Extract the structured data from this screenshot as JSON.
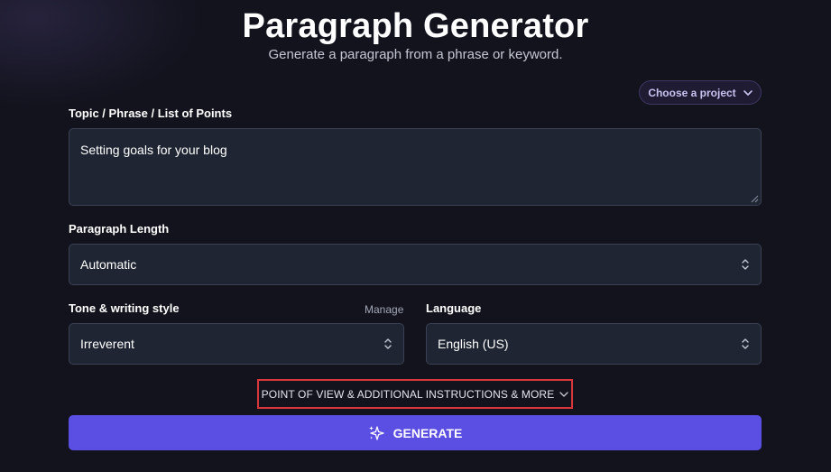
{
  "header": {
    "title": "Paragraph Generator",
    "subtitle": "Generate a paragraph from a phrase or keyword."
  },
  "project": {
    "label": "Choose a project",
    "icon": "chevron-down-icon"
  },
  "topic": {
    "label": "Topic / Phrase / List of Points",
    "value": "Setting goals for your blog"
  },
  "length": {
    "label": "Paragraph Length",
    "value": "Automatic",
    "icon": "chevron-up-down-icon"
  },
  "tone": {
    "label": "Tone & writing style",
    "manage_label": "Manage",
    "value": "Irreverent",
    "icon": "chevron-up-down-icon"
  },
  "language": {
    "label": "Language",
    "value": "English (US)",
    "icon": "chevron-up-down-icon"
  },
  "more_options": {
    "label": "POINT OF VIEW & ADDITIONAL INSTRUCTIONS & MORE",
    "icon": "chevron-down-icon",
    "highlight_color": "#d9373c"
  },
  "generate": {
    "label": "GENERATE",
    "icon": "sparkle-icon",
    "color": "#5b4ee3"
  }
}
